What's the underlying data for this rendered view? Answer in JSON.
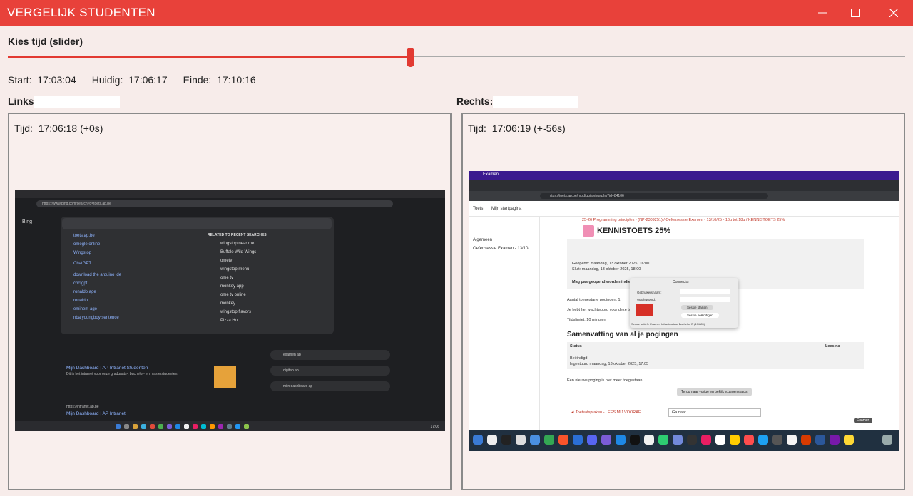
{
  "window": {
    "title": "VERGELIJK STUDENTEN",
    "minimize_icon": "minimize-icon",
    "maximize_icon": "maximize-icon",
    "close_icon": "close-icon",
    "accent": "#e8413a"
  },
  "slider": {
    "label": "Kies tijd (slider)",
    "position_fraction": 0.448
  },
  "times": {
    "start_label": "Start:",
    "start_value": "17:03:04",
    "current_label": "Huidig:",
    "current_value": "17:06:17",
    "end_label": "Einde:",
    "end_value": "17:10:16"
  },
  "left": {
    "label": "Links:",
    "name": "",
    "time_label": "Tijd:",
    "time_value": "17:06:18 (+0s)",
    "screenshot": {
      "app": "Bing",
      "url": "https://www.bing.com/search?q=toets.ap.be",
      "suggestions": [
        "toets.ap.be",
        "omegle online",
        "Wingstop",
        "ChatGPT",
        "download the arduino ide",
        "chctgpt",
        "ronaldo age",
        "ronaldo",
        "eminem age",
        "nba youngboy sentence"
      ],
      "related_heading": "RELATED TO RECENT SEARCHES",
      "related": [
        "wingstop near me",
        "Buffalo Wild Wings",
        "ometv",
        "wingstop menu",
        "ome tv",
        "monkey app",
        "ome tv online",
        "monkey",
        "wingstop flavors",
        "Pizza Hut"
      ],
      "pills": [
        "examen ap",
        "digitab ap",
        "mijn dashboard ap"
      ],
      "results": [
        {
          "title": "Mijn Dashboard | AP Intranet Studenten",
          "text": "Dit is het intranet voor onze graduaats-, bachelor- en masterstudenten."
        },
        {
          "title": "Mijn Dashboard | AP Intranet",
          "text": "https://intranet.ap.be"
        }
      ],
      "clock": "17:06"
    }
  },
  "right": {
    "label": "Rechts:",
    "name": "",
    "time_label": "Tijd:",
    "time_value": "17:06:19 (+-56s)",
    "screenshot": {
      "app": "Examen",
      "url": "https://toets.ap.be/mod/quiz/view.php?id=84106",
      "nav_items": [
        "Toets",
        "Mijn startpagina"
      ],
      "sidebar_items": [
        "Algemeen",
        "Oefensessie Examen - 13/10/..."
      ],
      "breadcrumb": "25-26 Programming principles - (NP-2309251) / Oefensessie Examen - 13/10/25 - 16u tot 18u / KENNISTOETS 25%",
      "quiz_title": "KENNISTOETS 25%",
      "opened": "Geopend: maandag, 13 oktober 2025, 16:00",
      "closes": "Sluit: maandag, 13 oktober 2025, 18:00",
      "notice": "Mag pas geopend worden indien...",
      "attempts_allowed": "Aantal toegestane pogingen: 1",
      "password_note": "Je hebt het wachtwoord voor deze toets nodig",
      "time_limit": "Tijdslimiet: 10 minuten",
      "summary_heading": "Samenvatting van al je pogingen",
      "status_col": "Status",
      "review_col": "Lees na",
      "status_value": "Beëindigd",
      "submitted": "Ingestuurd maandag, 13 oktober 2025, 17:05",
      "no_more": "Een nieuwe poging is niet meer toegestaan",
      "back_button": "Terug naar vorige en bekijk examenstatus",
      "footer_link": "◄ Toetsafspraken - LEES MIJ VOORAF",
      "goto_select": "Ga naar...",
      "dialog": {
        "title": "Connector",
        "username_label": "Gebruikersnaam:",
        "password_label": "Wachtwoord:",
        "start_button": "Sessie starten",
        "end_button": "Sessie beëindigen",
        "status": "Sessie actief - Examen Infrastructuur Bachelor IT (17/885)"
      },
      "dock_tooltip": "Examen"
    }
  }
}
